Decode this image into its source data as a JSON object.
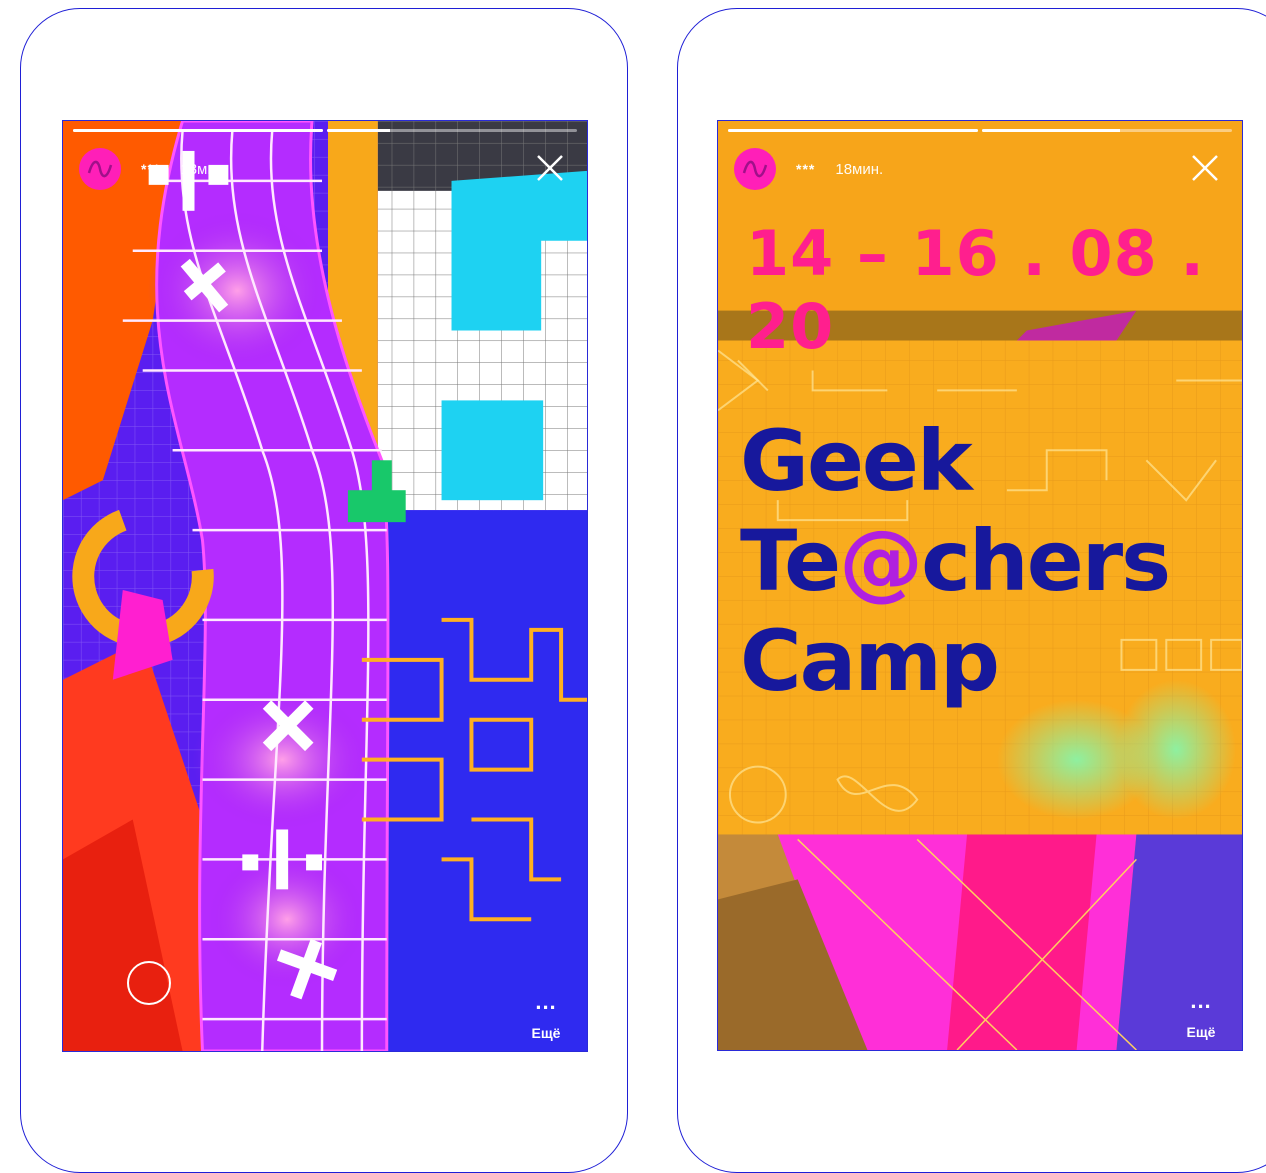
{
  "stories": [
    {
      "username": "***",
      "time": "18мин.",
      "more_label": "Ещё",
      "more_dots": "...",
      "progress": [
        1.0,
        0.25
      ]
    },
    {
      "username": "***",
      "time": "18мин.",
      "more_label": "Ещё",
      "more_dots": "...",
      "progress": [
        1.0,
        0.55
      ],
      "date": "14 – 16 . 08 . 20",
      "title_line1": "Geek",
      "title_line2_a": "Te",
      "title_line2_at": "@",
      "title_line2_b": "chers",
      "title_line3": "Camp"
    }
  ],
  "colors": {
    "frame_border": "#1f1fd6",
    "avatar": "#ff1fb8",
    "story2_bg": "#f7a51a",
    "date_text": "#ff1f8e",
    "title_text": "#17189c",
    "at_accent": "#b020e0"
  },
  "icons": [
    "avatar-logo-icon",
    "close-icon",
    "more-dots-icon",
    "record-circle-icon"
  ]
}
